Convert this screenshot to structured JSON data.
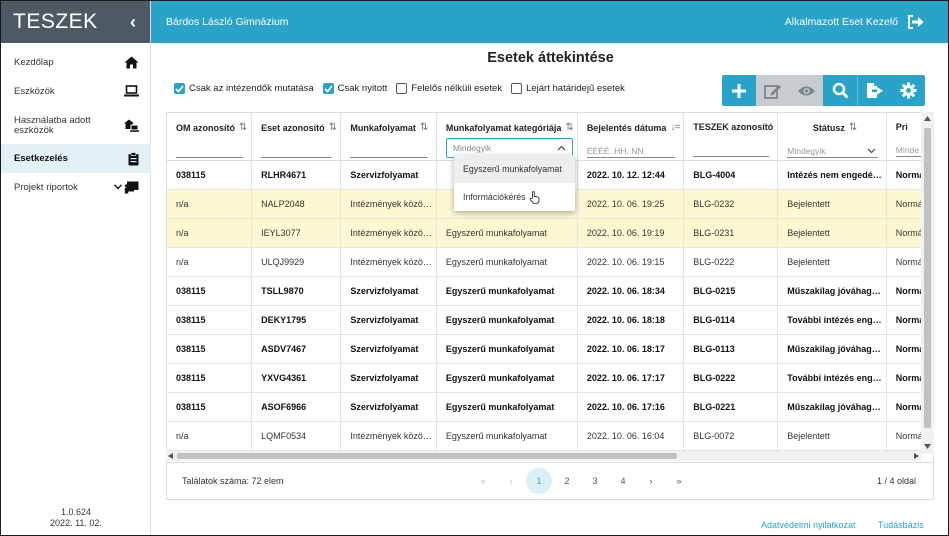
{
  "app": {
    "name": "TESZEK",
    "collapse": "‹",
    "version": "1.0.624",
    "date": "2022. 11. 02."
  },
  "topbar": {
    "school": "Bárdos László Gimnázium",
    "user": "Alkalmazott Eset Kezelő"
  },
  "sidebar": {
    "items": [
      {
        "label": "Kezdőlap",
        "icon": "home-icon"
      },
      {
        "label": "Eszközök",
        "icon": "laptop-icon"
      },
      {
        "label": "Használatba adott eszközök",
        "icon": "house-laptop-icon"
      },
      {
        "label": "Esetkezelés",
        "icon": "clipboard-icon",
        "active": true
      },
      {
        "label": "Projekt riportok",
        "icon": "presentation-icon"
      }
    ]
  },
  "page": {
    "title": "Esetek áttekintése"
  },
  "filters": [
    {
      "label": "Csak az intézendők mutatása",
      "checked": true
    },
    {
      "label": "Csak nyitott",
      "checked": true
    },
    {
      "label": "Felelős nélküli esetek",
      "checked": false
    },
    {
      "label": "Lejárt határidejű esetek",
      "checked": false
    }
  ],
  "toolbar": {
    "buttons": [
      "plus-icon",
      "edit-icon",
      "view-icon",
      "search-icon",
      "export-icon",
      "settings-icon"
    ]
  },
  "table": {
    "columns": [
      {
        "label": "OM azonosító",
        "sort": "⇅"
      },
      {
        "label": "Eset azonosító",
        "sort": "⇅"
      },
      {
        "label": "Munkafolyamat",
        "sort": "⇅"
      },
      {
        "label": "Munkafolyamat kategóriája",
        "sort": "⇅",
        "select": "Mindegyik"
      },
      {
        "label": "Bejelentés dátuma",
        "sort": "↓=",
        "placeholder": "ÉÉÉÉ. HH. NN."
      },
      {
        "label": "TESZEK azonosító",
        "sort": ""
      },
      {
        "label": "Státusz",
        "sort": "⇅",
        "select": "Mindegyik"
      },
      {
        "label": "Pri",
        "sort": "",
        "select": "Minde"
      }
    ],
    "rows": [
      {
        "bold": true,
        "hl": false,
        "cells": [
          "038115",
          "RLHR4671",
          "Szervizfolyamat",
          "",
          "2022. 10. 12. 12:44",
          "BLG-4004",
          "Intézés nem engedé…",
          "Normál"
        ]
      },
      {
        "bold": false,
        "hl": true,
        "cells": [
          "n/a",
          "NALP2048",
          "Intézmények közö…",
          "",
          "2022. 10. 06. 19:25",
          "BLG-0232",
          "Bejelentett",
          "Normál"
        ]
      },
      {
        "bold": false,
        "hl": true,
        "cells": [
          "n/a",
          "IEYL3077",
          "Intézmények közö…",
          "Egyszerű munkafolyamat",
          "2022. 10. 06. 19:19",
          "BLG-0231",
          "Bejelentett",
          "Normál"
        ]
      },
      {
        "bold": false,
        "hl": false,
        "cells": [
          "n/a",
          "ULQJ9929",
          "Intézmények közö…",
          "Egyszerű munkafolyamat",
          "2022. 10. 06. 19:15",
          "BLG-0222",
          "Bejelentett",
          "Normál"
        ]
      },
      {
        "bold": true,
        "hl": false,
        "cells": [
          "038115",
          "TSLL9870",
          "Szervizfolyamat",
          "Egyszerű munkafolyamat",
          "2022. 10. 06. 18:34",
          "BLG-0215",
          "Műszakilag jóváhag…",
          "Normál"
        ]
      },
      {
        "bold": true,
        "hl": false,
        "cells": [
          "038115",
          "DEKY1795",
          "Szervizfolyamat",
          "Egyszerű munkafolyamat",
          "2022. 10. 06. 18:18",
          "BLG-0114",
          "További intézés eng…",
          "Normál"
        ]
      },
      {
        "bold": true,
        "hl": false,
        "cells": [
          "038115",
          "ASDV7467",
          "Szervizfolyamat",
          "Egyszerű munkafolyamat",
          "2022. 10. 06. 18:17",
          "BLG-0113",
          "Műszakilag jóváhag…",
          "Normál"
        ]
      },
      {
        "bold": true,
        "hl": false,
        "cells": [
          "038115",
          "YXVG4361",
          "Szervizfolyamat",
          "Egyszerű munkafolyamat",
          "2022. 10. 06. 17:17",
          "BLG-0222",
          "További intézés eng…",
          "Normál"
        ]
      },
      {
        "bold": true,
        "hl": false,
        "cells": [
          "038115",
          "ASOF6966",
          "Szervizfolyamat",
          "Egyszerű munkafolyamat",
          "2022. 10. 06. 17:16",
          "BLG-0221",
          "Műszakilag jóváhag…",
          "Normál"
        ]
      },
      {
        "bold": false,
        "hl": false,
        "cells": [
          "n/a",
          "LQMF0534",
          "Intézmények közö…",
          "Egyszerű munkafolyamat",
          "2022. 10. 06. 16:04",
          "BLG-0072",
          "Bejelentett",
          "Normál"
        ]
      }
    ]
  },
  "dropdown": {
    "options": [
      "Egyszerű munkafolyamat",
      "Információkérés"
    ]
  },
  "pager": {
    "count_label": "Találatok száma: 72 elem",
    "first": "«",
    "prev": "‹",
    "pages": [
      "1",
      "2",
      "3",
      "4"
    ],
    "current": "1",
    "next": "›",
    "last": "»",
    "page_info": "1 / 4 oldal"
  },
  "footer": {
    "privacy": "Adatvédelmi nyilatkozat",
    "kb": "Tudásbázis"
  }
}
